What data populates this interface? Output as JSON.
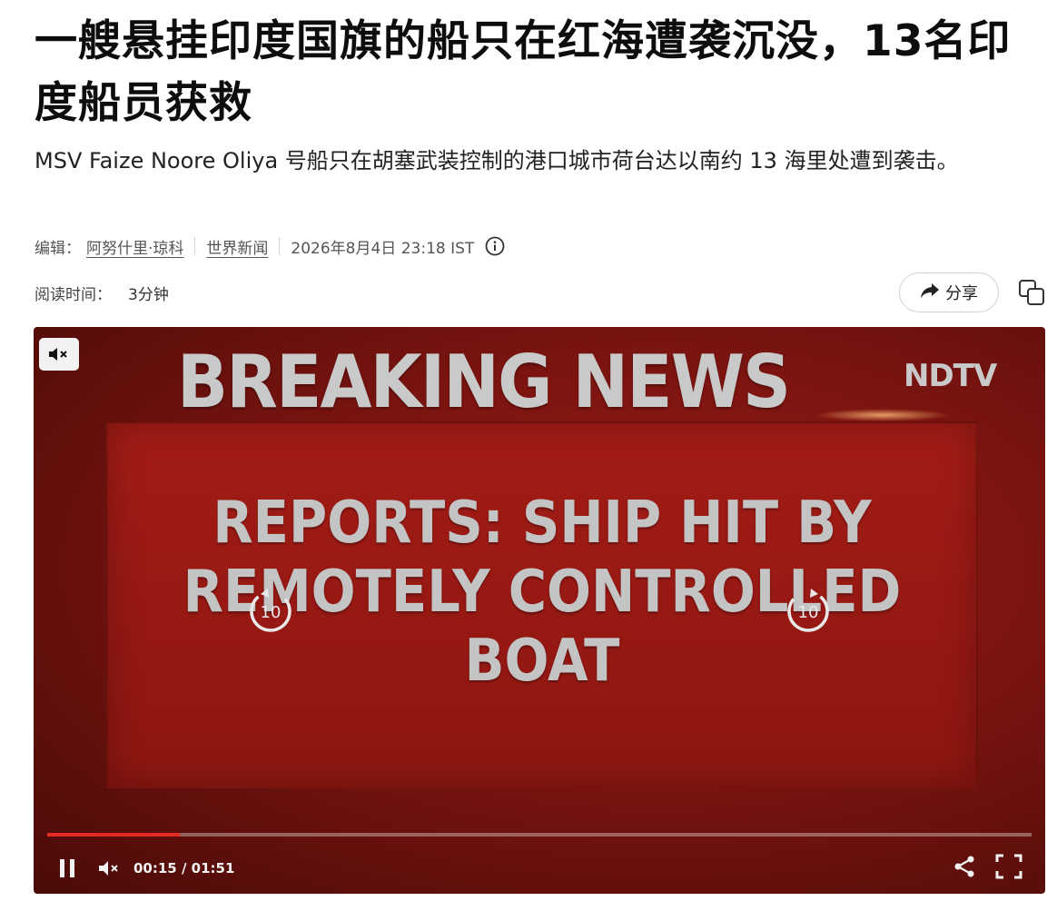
{
  "article": {
    "headline": "一艘悬挂印度国旗的船只在红海遭袭沉没，13名印度船员获救",
    "subtitle": "MSV Faize Noore Oliya 号船只在胡塞武装控制的港口城市荷台达以南约 13 海里处遭到袭击。",
    "editor_label": "编辑：",
    "editor_name": "阿努什里·琼科",
    "category": "世界新闻",
    "date": "2026年8月4日 23:18 IST",
    "read_time_label": "阅读时间：",
    "read_time_value": "3分钟",
    "share_label": "分享"
  },
  "video": {
    "headline_top": "BREAKING NEWS",
    "brand": "NDTV",
    "line1": "REPORTS:  SHIP HIT BY",
    "line2": "REMOTELY CONTROLLED",
    "line3": "BOAT",
    "skip_back": "10",
    "skip_forward": "10",
    "time_display": "00:15 / 01:51",
    "progress_fraction": 0.135,
    "accent_color": "#e32b22"
  },
  "icons": [
    "info-icon",
    "share-arrow-icon",
    "copy-icon",
    "mute-icon",
    "replay-10-icon",
    "forward-10-icon",
    "pause-icon",
    "share-icon",
    "fullscreen-icon"
  ]
}
